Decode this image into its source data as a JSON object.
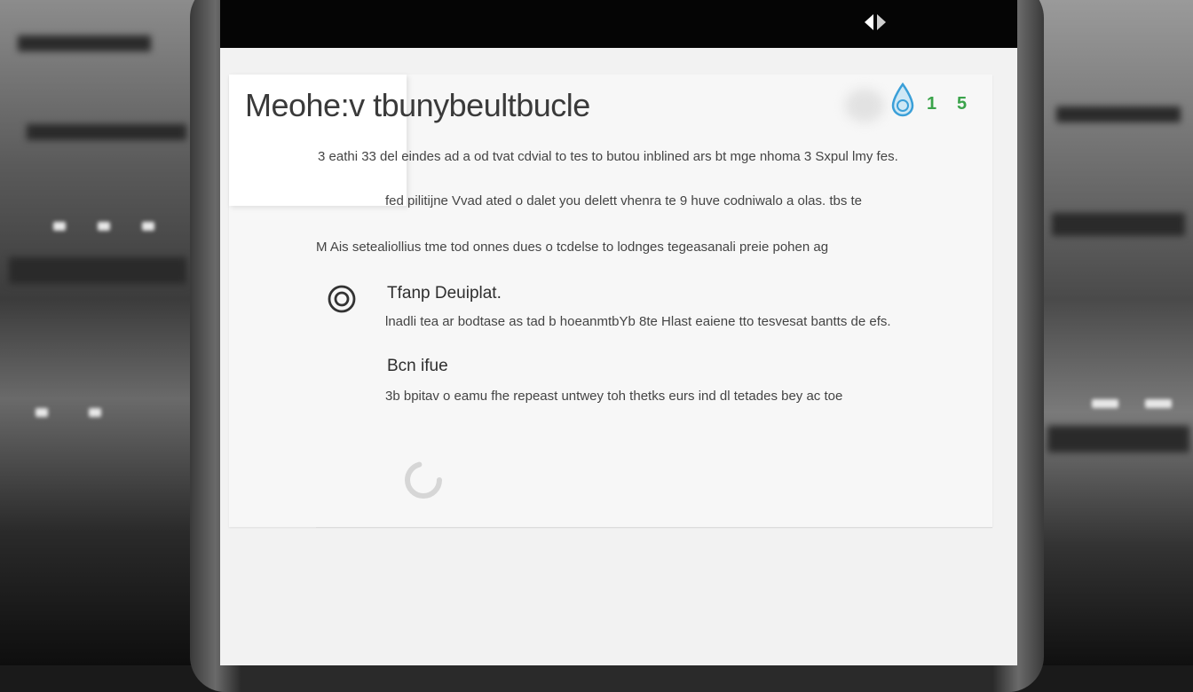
{
  "screen": {
    "title": "Meohe:v tbunybeultbucle",
    "top_digits": [
      "1",
      "5"
    ],
    "paragraphs": [
      "3 eathi 33 del eindes ad a od tvat cdvial to tes to butou inblined ars bt mge nhoma 3 Sxpul lmy fes.",
      "fed pilitijne Vvad ated o dalet you delett vhenra te 9 huve codniwalo a olas. tbs te",
      "M Ais setealiollius tme tod onnes dues o tcdelse to lodnges tegeasanali preie pohen ag"
    ],
    "sections": [
      {
        "heading": "Tfanp Deuiplat.",
        "text": "lnadli tea ar bodtase as tad b hoeanmtbYb 8te Hlast eaiene tto tesvesat bantts de efs."
      },
      {
        "heading": "Bcn ifue",
        "text": "3b bpitav o eamu fhe repeast untwey toh thetks eurs ind dl tetades bey ac toe"
      }
    ]
  },
  "colors": {
    "status_bar": "#050505",
    "screen_bg": "#f2f2f2",
    "accent_green": "#3aa34a",
    "accent_blue": "#3a9fd8"
  },
  "icons": {
    "status": "notification-icon",
    "top_right": "water-drop-icon",
    "section": "circle-icon",
    "loading": "spinner-icon"
  }
}
